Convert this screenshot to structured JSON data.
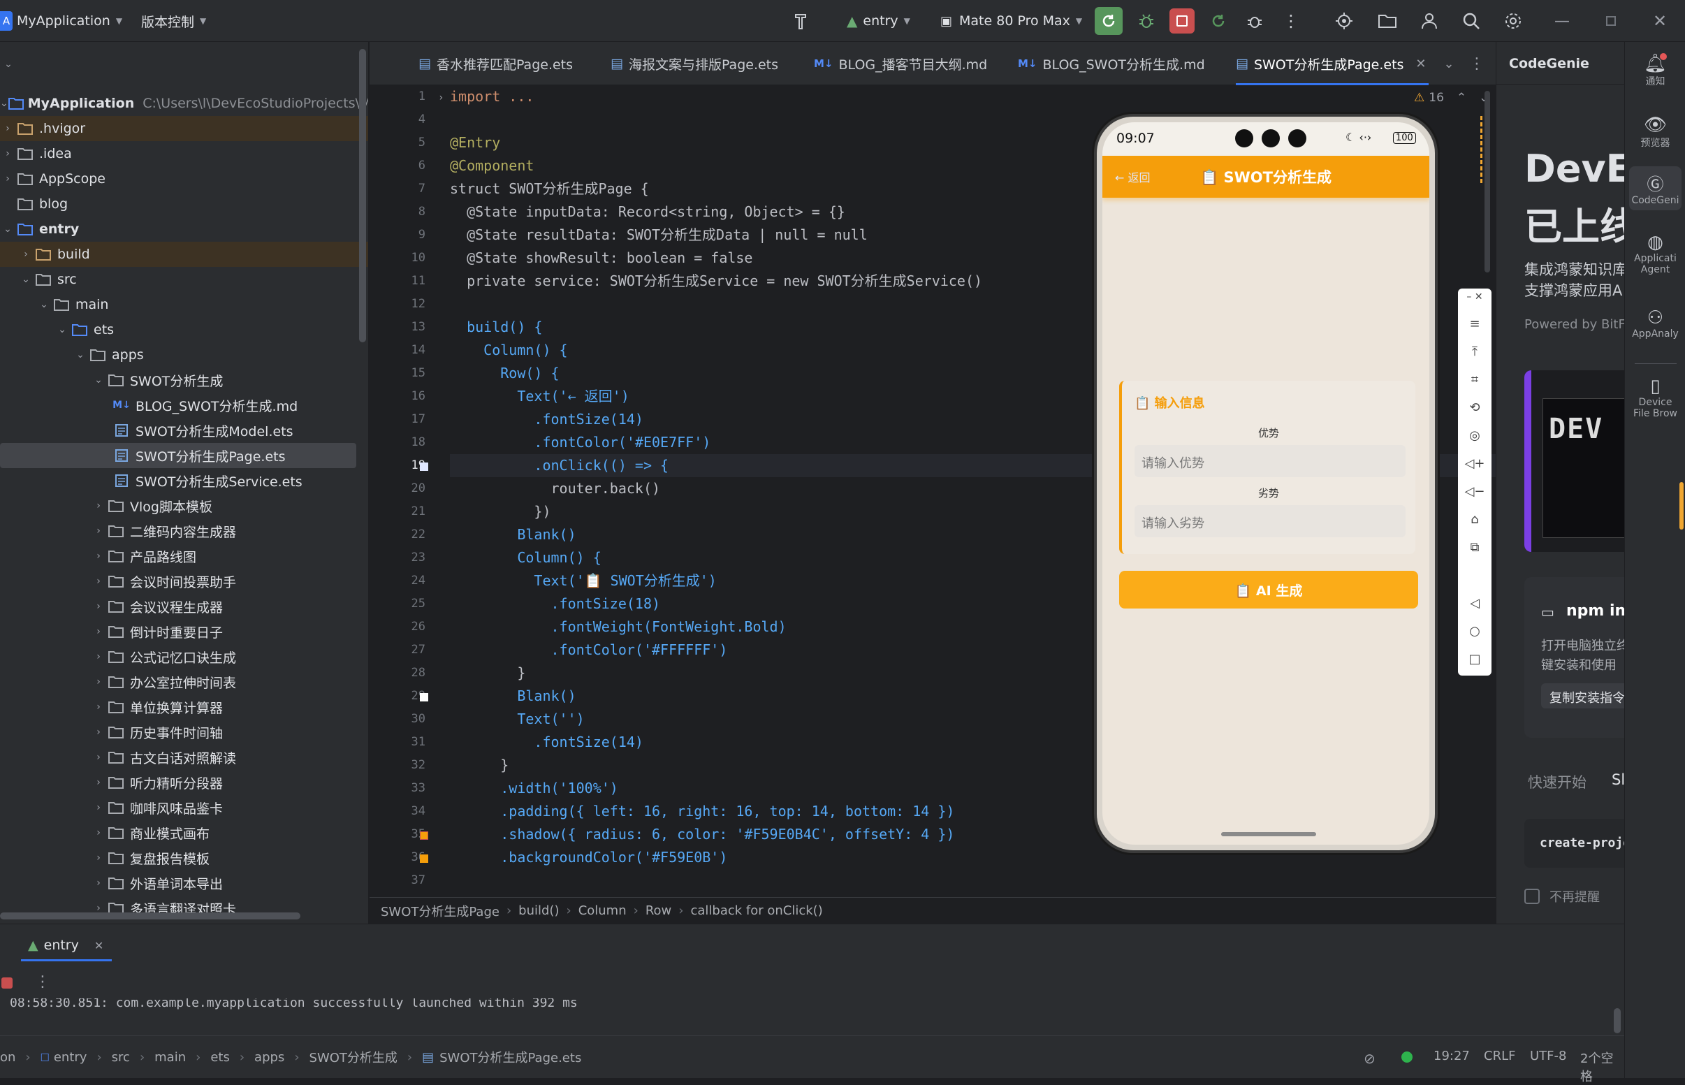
{
  "titlebar": {
    "app_name": "MyApplication",
    "vcs": "版本控制",
    "run_config": "entry",
    "device": "Mate 80 Pro Max"
  },
  "project": {
    "root_name": "MyApplication",
    "root_path": "C:\\Users\\l\\DevEcoStudioProjects\\MyApplic",
    "items": [
      {
        "label": ".hvigor"
      },
      {
        "label": ".idea"
      },
      {
        "label": "AppScope"
      },
      {
        "label": "blog"
      },
      {
        "label": "entry"
      },
      {
        "label": "build"
      },
      {
        "label": "src"
      },
      {
        "label": "main"
      },
      {
        "label": "ets"
      },
      {
        "label": "apps"
      },
      {
        "label": "SWOT分析生成"
      },
      {
        "label": "BLOG_SWOT分析生成.md"
      },
      {
        "label": "SWOT分析生成Model.ets"
      },
      {
        "label": "SWOT分析生成Page.ets"
      },
      {
        "label": "SWOT分析生成Service.ets"
      },
      {
        "label": "Vlog脚本模板"
      },
      {
        "label": "二维码内容生成器"
      },
      {
        "label": "产品路线图"
      },
      {
        "label": "会议时间投票助手"
      },
      {
        "label": "会议议程生成器"
      },
      {
        "label": "倒计时重要日子"
      },
      {
        "label": "公式记忆口诀生成"
      },
      {
        "label": "办公室拉伸时间表"
      },
      {
        "label": "单位换算计算器"
      },
      {
        "label": "历史事件时间轴"
      },
      {
        "label": "古文白话对照解读"
      },
      {
        "label": "听力精听分段器"
      },
      {
        "label": "咖啡风味品鉴卡"
      },
      {
        "label": "商业模式画布"
      },
      {
        "label": "复盘报告模板"
      },
      {
        "label": "外语单词本导出"
      },
      {
        "label": "多语言翻译对照卡"
      }
    ]
  },
  "tabs": [
    {
      "label": "香水推荐匹配Page.ets"
    },
    {
      "label": "海报文案与排版Page.ets"
    },
    {
      "label": "BLOG_播客节目大纲.md"
    },
    {
      "label": "BLOG_SWOT分析生成.md"
    },
    {
      "label": "SWOT分析生成Page.ets"
    }
  ],
  "editor": {
    "warning_count": "16",
    "line_numbers": [
      "1",
      "4",
      "5",
      "6",
      "7",
      "8",
      "9",
      "10",
      "11",
      "12",
      "13",
      "14",
      "15",
      "16",
      "17",
      "18",
      "19",
      "20",
      "21",
      "22",
      "23",
      "24",
      "25",
      "26",
      "27",
      "28",
      "29",
      "30",
      "31",
      "32",
      "33",
      "34",
      "35",
      "36",
      "37"
    ],
    "lines": [
      "import ...",
      "",
      "@Entry",
      "@Component",
      "struct SWOT分析生成Page {",
      "  @State inputData: Record<string, Object> = {}",
      "  @State resultData: SWOT分析生成Data | null = null",
      "  @State showResult: boolean = false",
      "  private service: SWOT分析生成Service = new SWOT分析生成Service()",
      "",
      "  build() {",
      "    Column() {",
      "      Row() {",
      "        Text('← 返回')",
      "          .fontSize(14)",
      "          .fontColor('#E0E7FF')",
      "          .onClick(() => {",
      "            router.back()",
      "          })",
      "        Blank()",
      "        Column() {",
      "          Text('📋 SWOT分析生成')",
      "            .fontSize(18)",
      "            .fontWeight(FontWeight.Bold)",
      "            .fontColor('#FFFFFF')",
      "        }",
      "        Blank()",
      "        Text('')",
      "          .fontSize(14)",
      "      }",
      "      .width('100%')",
      "      .padding({ left: 16, right: 16, top: 14, bottom: 14 })",
      "      .shadow({ radius: 6, color: '#F59E0B4C', offsetY: 4 })",
      "      .backgroundColor('#F59E0B')",
      ""
    ]
  },
  "breadcrumb": [
    "SWOT分析生成Page",
    "build()",
    "Column",
    "Row",
    "callback for onClick()"
  ],
  "phone": {
    "time": "09:07",
    "battery": "100",
    "back_label": "← 返回",
    "title": "📋 SWOT分析生成",
    "card_title": "📋 输入信息",
    "field1_label": "优势",
    "field1_placeholder": "请输入优势",
    "field2_label": "劣势",
    "field2_placeholder": "请输入劣势",
    "generate_button": "📋 AI 生成",
    "accent": "#F59E0B"
  },
  "codegenie": {
    "title": "CodeGenie",
    "hero_line1": "DevEc",
    "hero_line2": "已上线",
    "desc1": "集成鸿蒙知识库",
    "desc2": "支撑鸿蒙应用A",
    "powered": "Powered by BitFu",
    "npm_title": "npm ins",
    "npm_desc1": "打开电脑独立终",
    "npm_desc2": "键安装和使用",
    "copy_button": "复制安装指令",
    "tab_quickstart": "快速开始",
    "tab_sl": "Sl",
    "create_project": "create-proje",
    "dont_remind": "不再提醒"
  },
  "rightbar": [
    {
      "label": "通知"
    },
    {
      "label": "预览器"
    },
    {
      "label": "CodeGeni"
    },
    {
      "label": "Applicati Agent"
    },
    {
      "label": "AppAnaly"
    },
    {
      "label": "Device File Brow"
    }
  ],
  "run_panel": {
    "tab": "entry",
    "log": "08:58:30.851: com.example.myapplication successfully launched within 392 ms"
  },
  "statusbar": {
    "path": [
      "on",
      "entry",
      "src",
      "main",
      "ets",
      "apps",
      "SWOT分析生成",
      "SWOT分析生成Page.ets"
    ],
    "position": "19:27",
    "line_sep": "CRLF",
    "encoding": "UTF-8",
    "indent": "2个空格"
  }
}
